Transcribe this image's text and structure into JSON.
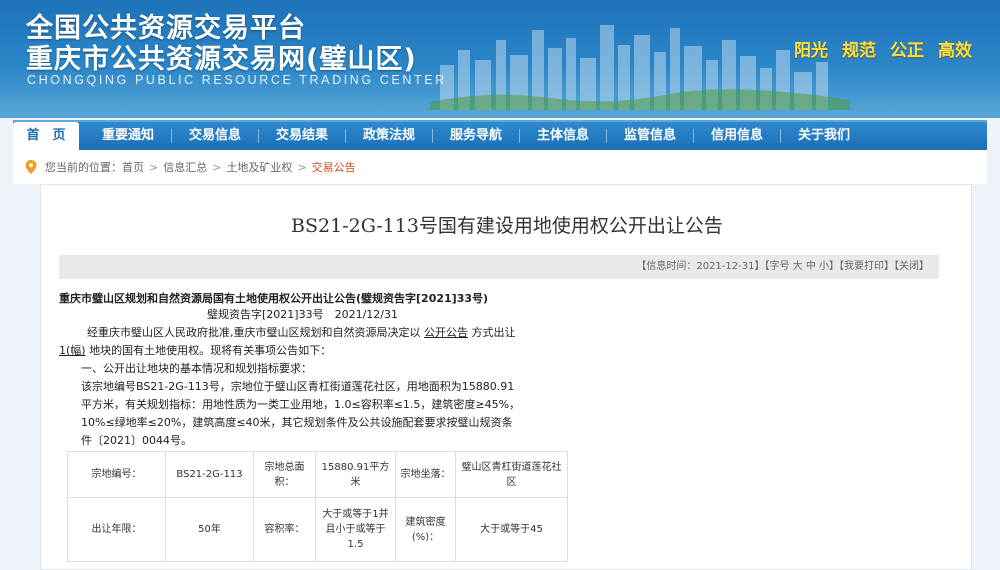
{
  "header": {
    "title_line1": "全国公共资源交易平台",
    "title_line2": "重庆市公共资源交易网(璧山区)",
    "title_en": "CHONGQING PUBLIC RESOURCE TRADING CENTER",
    "slogans": [
      "阳光",
      "规范",
      "公正",
      "高效"
    ]
  },
  "nav": {
    "items": [
      "首　页",
      "重要通知",
      "交易信息",
      "交易结果",
      "政策法规",
      "服务导航",
      "主体信息",
      "监管信息",
      "信用信息",
      "关于我们"
    ]
  },
  "breadcrumb": {
    "prefix": "您当前的位置：",
    "items": [
      "首页",
      "信息汇总",
      "土地及矿业权",
      "交易公告"
    ],
    "separator": ">"
  },
  "article": {
    "title": "BS21-2G-113号国有建设用地使用权公开出让公告",
    "info_bar": "【信息时间：2021-12-31】【字号 大 中 小】【我要打印】【关闭】",
    "lines": {
      "title_line": "重庆市璧山区规划和自然资源局国有土地使用权公开出让公告(璧规资告字[2021]33号)",
      "doc_no": "璧规资告字[2021]33号　2021/12/31",
      "intro_a": "经重庆市璧山区人民政府批准,重庆市璧山区规划和自然资源局决定以",
      "intro_link": "公开公告",
      "intro_b": "方式出让",
      "intro2_a": "1(幅)",
      "intro2_b": "地块的国有土地使用权。现将有关事项公告如下：",
      "s1": "一、公开出让地块的基本情况和规划指标要求：",
      "d1": "该宗地编号BS21-2G-113号，宗地位于璧山区青杠街道莲花社区，用地面积为15880.91",
      "d2": "平方米，有关规划指标：用地性质为一类工业用地，1.0≤容积率≤1.5，建筑密度≥45%，",
      "d3": "10%≤绿地率≤20%，建筑高度≤40米，其它规划条件及公共设施配套要求按璧山规资条",
      "d4": "件〔2021〕0044号。"
    }
  },
  "table": {
    "row1": [
      "宗地编号：",
      "BS21-2G-113",
      "宗地总面积：",
      "15880.91平方米",
      "宗地坐落：",
      "璧山区青杠街道莲花社区"
    ],
    "row2": [
      "出让年限：",
      "50年",
      "容积率：",
      "大于或等于1并且小于或等于1.5",
      "建筑密度(%)：",
      "大于或等于45"
    ]
  },
  "colors": {
    "banner": "#1e73b8",
    "nav": "#1b6fb5",
    "slogan": "#ffe13c",
    "breadcrumb_current": "#d04c1e"
  }
}
